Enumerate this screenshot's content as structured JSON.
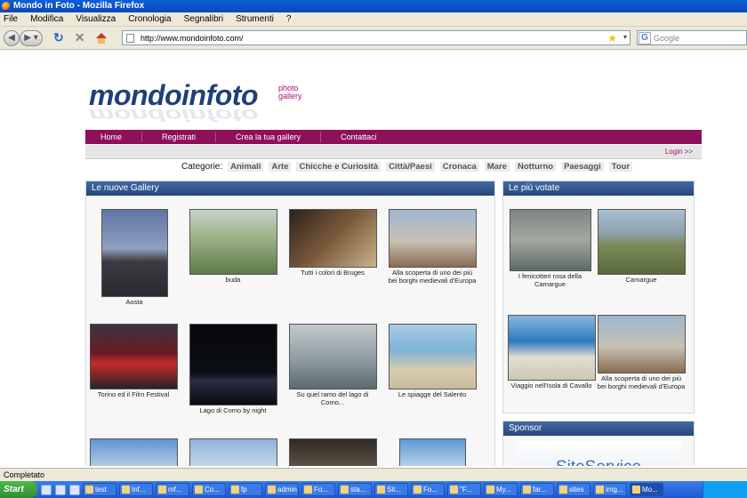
{
  "window": {
    "title": "Mondo in Foto - Mozilla Firefox"
  },
  "menu": [
    "File",
    "Modifica",
    "Visualizza",
    "Cronologia",
    "Segnalibri",
    "Strumenti",
    "?"
  ],
  "nav": {
    "url": "http://www.mondoinfoto.com/",
    "search_placeholder": "Google"
  },
  "site": {
    "logo": "mondoinfoto",
    "tagline_1": "photo",
    "tagline_2": "gallery",
    "menu": [
      "Home",
      "Registrati",
      "Crea la tua gallery",
      "Contattaci"
    ],
    "login": "Login >>",
    "categories_label": "Categorie:",
    "categories": [
      "Animali",
      "Arte",
      "Chicche e Curiosità",
      "Città/Paesi",
      "Cronaca",
      "Mare",
      "Notturno",
      "Paesaggi",
      "Tour"
    ]
  },
  "new_gallery": {
    "title": "Le nuove Gallery",
    "items": [
      {
        "caption": "Aosta",
        "color_a": "#6a7da8",
        "color_b": "#2f3344"
      },
      {
        "caption": "buda",
        "color_a": "#7ea36b",
        "color_b": "#b8c2b6"
      },
      {
        "caption": "Tutti i colori di Bruges",
        "color_a": "#3a2f2c",
        "color_b": "#a89b7a"
      },
      {
        "caption": "Alla scoperta di uno dei più bei borghi medievali d'Europa",
        "color_a": "#8fa6c2",
        "color_b": "#c6b8a4"
      },
      {
        "caption": "Torino ed il Film Festival",
        "color_a": "#2a2028",
        "color_b": "#c42a2a"
      },
      {
        "caption": "Lago di Como by night",
        "color_a": "#0b0b10",
        "color_b": "#1b1f2c"
      },
      {
        "caption": "Su quel ramo del lago di Como...",
        "color_a": "#a9b3b7",
        "color_b": "#5e6b70"
      },
      {
        "caption": "Le spiagge del Salento",
        "color_a": "#9ec7e3",
        "color_b": "#d9cdb2"
      },
      {
        "caption": "",
        "color_a": "#7aa6d8",
        "color_b": "#c9d7e6"
      },
      {
        "caption": "",
        "color_a": "#9fbfe0",
        "color_b": "#d4dfe9"
      },
      {
        "caption": "",
        "color_a": "#3c3530",
        "color_b": "#6b5a4a"
      },
      {
        "caption": "",
        "color_a": "#6fa3d8",
        "color_b": "#cfe0ef"
      }
    ]
  },
  "top_voted": {
    "title": "Le più votate",
    "items": [
      {
        "caption": "I fenicotteri rosa della Camargue",
        "color_a": "#6f7a78",
        "color_b": "#a4aaa0"
      },
      {
        "caption": "Camargue",
        "color_a": "#9bb3c9",
        "color_b": "#7b8a5a"
      },
      {
        "caption": "Viaggio nell'Isola di Cavallo",
        "color_a": "#2d79c2",
        "color_b": "#e1ddd0"
      },
      {
        "caption": "Alla scoperta di uno dei più bei borghi medievali d'Europa",
        "color_a": "#8fa6c2",
        "color_b": "#c6b8a4"
      }
    ]
  },
  "sponsor": {
    "title": "Sponsor",
    "text": "SiteService"
  },
  "status": "Completato",
  "taskbar": {
    "start": "Start",
    "tasks": [
      "test",
      "Inf...",
      "mf...",
      "Co...",
      "fp",
      "admin",
      "Fo...",
      "sta...",
      "Sit...",
      "Fo...",
      "\"F...",
      "My...",
      "far...",
      "sites",
      "img...",
      "Mo..."
    ]
  }
}
